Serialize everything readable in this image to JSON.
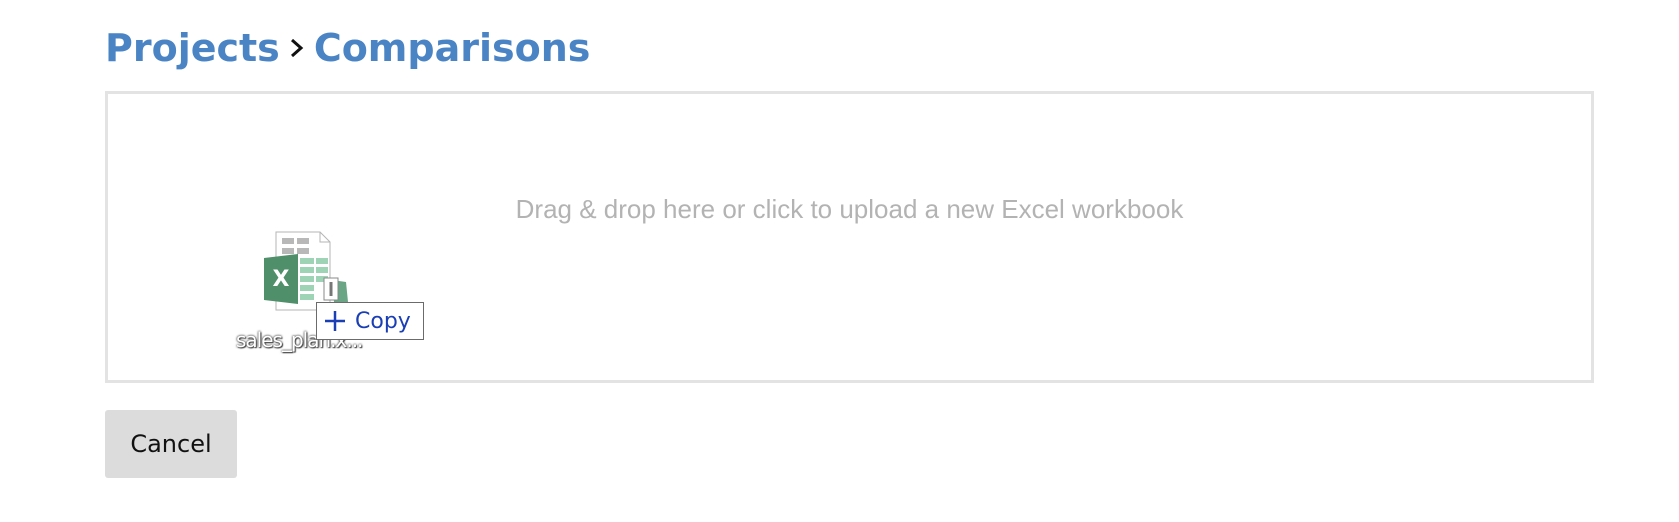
{
  "breadcrumb": {
    "items": [
      {
        "label": "Projects"
      },
      {
        "label": "Comparisons"
      }
    ],
    "separator_icon": "chevron-right-icon"
  },
  "dropzone": {
    "prompt": "Drag & drop here or click to upload a new Excel workbook"
  },
  "drag_ghost": {
    "file_name": "sales_plan.x...",
    "file_icon": "excel-file-icon",
    "badge_icon": "plus-icon",
    "badge_label": "Copy"
  },
  "actions": {
    "cancel_label": "Cancel"
  },
  "colors": {
    "link": "#4a84c4",
    "dropzone_border": "#e3e3e3",
    "prompt_text": "#b3b3b3",
    "copy_text": "#1a3fb5",
    "excel_green": "#217346",
    "button_bg": "#dcdcdc"
  }
}
